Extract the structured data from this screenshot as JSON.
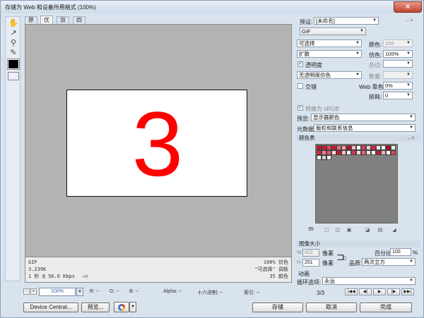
{
  "window": {
    "title": "存储为 Web 和设备所用格式 (100%)",
    "close_glyph": "✕"
  },
  "tools": [
    "hand-icon",
    "slice-select-icon",
    "zoom-icon",
    "eyedropper-icon"
  ],
  "view_tabs": [
    {
      "label": "原稿",
      "active": false
    },
    {
      "label": "优化",
      "active": true
    },
    {
      "label": "双联",
      "active": false
    },
    {
      "label": "四联",
      "active": false
    }
  ],
  "canvas": {
    "image_text": "3",
    "image_color": "#ff0000"
  },
  "info": {
    "left": [
      "GIF",
      "3.239K",
      "1 秒 @ 56.6 Kbps"
    ],
    "left_arrow": "→≡",
    "right": [
      "100% 仿色",
      "\"可选择\" 调板",
      "35 颜色"
    ]
  },
  "status": {
    "minus": "-",
    "plus": "+",
    "zoom": "100%",
    "r": "R: --",
    "g": "G: --",
    "b": "B: --",
    "alpha": "Alpha: --",
    "hex": "十六进制: --",
    "index": "索引: --"
  },
  "bottom_buttons": {
    "device_central": "Device Central...",
    "preview": "预览...",
    "save": "存储",
    "cancel": "取消",
    "done": "完成"
  },
  "settings": {
    "preset_label": "预设:",
    "preset_value": "[未命名]",
    "menu_glyph": "→≡",
    "format": "GIF",
    "reduction": "可选择",
    "colors_label": "颜色:",
    "colors_value": "256",
    "dither_algo": "扩散",
    "dither_label": "仿色:",
    "dither_value": "100%",
    "transparency_label": "透明度",
    "matte_label": "杂边:",
    "transparency_dither": "无透明度仿色",
    "amount_label": "数量:",
    "interlaced_label": "交错",
    "web_snap_label": "Web 靠色:",
    "web_snap_value": "0%",
    "lossy_label": "损耗:",
    "lossy_value": "0",
    "convert_srgb_label": "转换为 sRGB",
    "preview_label": "预览:",
    "preview_value": "显示器颜色",
    "metadata_label": "元数据:",
    "metadata_value": "版权和联系信息"
  },
  "color_table": {
    "header": "颜色表",
    "count": "35",
    "colors": [
      "#d4102a",
      "#e0152f",
      "#e8475a",
      "#d01a2c",
      "#ee6f7f",
      "#f2a0aa",
      "#c8081e",
      "#f4b8c0",
      "#ffffff",
      "#e63a50",
      "#f7cdd3",
      "#dc2840",
      "#fbe3e6",
      "#ffffff",
      "#b8001a",
      "#ffffff",
      "#e0203a",
      "#f08090",
      "#ea5568",
      "#f9d8dc",
      "#d80f28",
      "#f5c0c8",
      "#ffffff",
      "#e4304a",
      "#f9e0e4",
      "#ee6070",
      "#fce8ea",
      "#ffffff",
      "#d21830",
      "#f3b0b8",
      "#ffffff",
      "#e84058",
      "#ffffff",
      "#cccccc",
      "#eeeeee"
    ]
  },
  "image_size": {
    "header": "图像大小",
    "w_label": "W:",
    "w_value": "422",
    "h_label": "H:",
    "h_value": "251",
    "pixels": "像素",
    "percent_label": "百分比:",
    "percent_value": "100",
    "percent_sign": "%",
    "quality_label": "品质:",
    "quality_value": "两次立方"
  },
  "animation": {
    "header": "动画",
    "loop_label": "循环选项:",
    "loop_value": "永远",
    "frame": "3/3",
    "controls": [
      "first-frame-icon",
      "prev-frame-icon",
      "play-icon",
      "next-frame-icon",
      "last-frame-icon"
    ]
  }
}
